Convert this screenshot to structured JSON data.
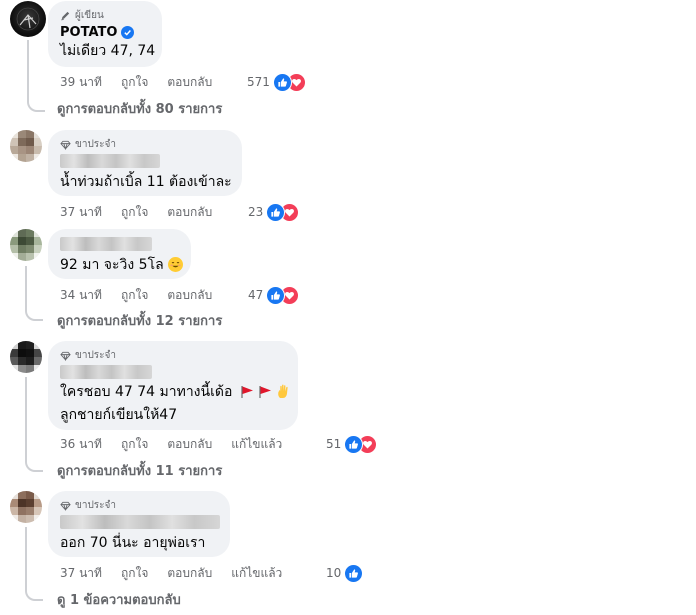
{
  "colors": {
    "accent": "#1877f2",
    "love": "#f33e58",
    "meta_text": "#65676b",
    "bubble": "#f0f2f5"
  },
  "comments": [
    {
      "badge_icon": "pencil-icon",
      "badge": "ผู้เขียน",
      "author": "POTATO",
      "verified": true,
      "text_lines": [
        "ไม่เดียว 47, 74"
      ],
      "time": "39 นาที",
      "like_label": "ถูกใจ",
      "reply_label": "ตอบกลับ",
      "edited_label": "",
      "reaction_count": "571",
      "reactions": [
        "like-icon",
        "love-icon"
      ],
      "view_replies": "ดูการตอบกลับทั้ง 80 รายการ"
    },
    {
      "badge_icon": "diamond-icon",
      "badge": "ขาประจำ",
      "author_blurred": true,
      "text_lines": [
        "น้ำท่วมถ้าเบิ้ล 11 ต้องเข้าละ"
      ],
      "time": "37 นาที",
      "like_label": "ถูกใจ",
      "reply_label": "ตอบกลับ",
      "edited_label": "",
      "reaction_count": "23",
      "reactions": [
        "like-icon",
        "love-icon"
      ],
      "view_replies": ""
    },
    {
      "badge_icon": "",
      "badge": "",
      "author_blurred": true,
      "text_lines": [
        "92 มา จะวิง 5โล"
      ],
      "emoji": "smiling-face-icon",
      "time": "34 นาที",
      "like_label": "ถูกใจ",
      "reply_label": "ตอบกลับ",
      "edited_label": "",
      "reaction_count": "47",
      "reactions": [
        "like-icon",
        "love-icon"
      ],
      "view_replies": "ดูการตอบกลับทั้ง 12 รายการ"
    },
    {
      "badge_icon": "diamond-icon",
      "badge": "ขาประจำ",
      "author_blurred": true,
      "text_lines": [
        "ใครชอบ 47 74 มาทางนี้เด้อ",
        "ลูกชายก์เขียนให้47"
      ],
      "emoji": "flags-and-hand-icons",
      "time": "36 นาที",
      "like_label": "ถูกใจ",
      "reply_label": "ตอบกลับ",
      "edited_label": "แก้ไขแล้ว",
      "reaction_count": "51",
      "reactions": [
        "like-icon",
        "love-icon"
      ],
      "view_replies": "ดูการตอบกลับทั้ง 11 รายการ"
    },
    {
      "badge_icon": "diamond-icon",
      "badge": "ขาประจำ",
      "author_blurred": true,
      "text_lines": [
        "ออก 70 นี่นะ อายุพ่อเรา"
      ],
      "time": "37 นาที",
      "like_label": "ถูกใจ",
      "reply_label": "ตอบกลับ",
      "edited_label": "แก้ไขแล้ว",
      "reaction_count": "10",
      "reactions": [
        "like-icon"
      ],
      "view_replies": "ดู 1 ข้อความตอบกลับ"
    }
  ]
}
